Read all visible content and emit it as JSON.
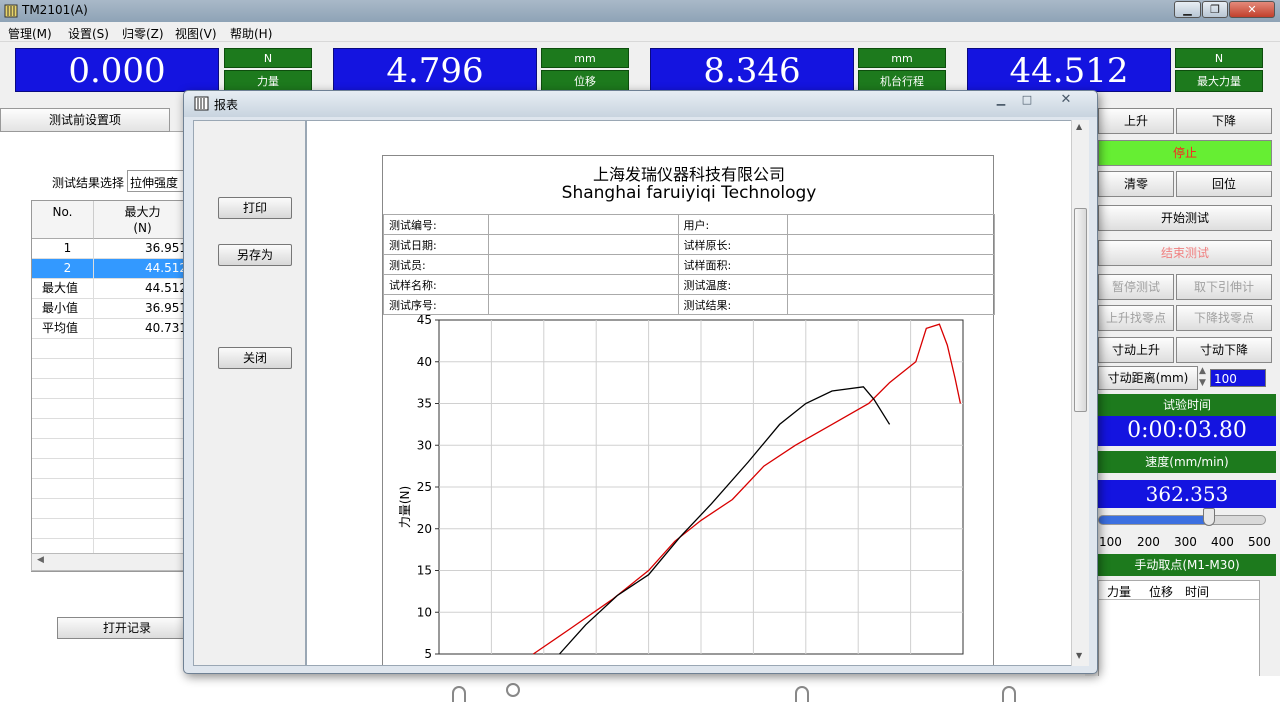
{
  "window": {
    "title": "TM2101(A)"
  },
  "menu": [
    "管理(M)",
    "设置(S)",
    "归零(Z)",
    "视图(V)",
    "帮助(H)"
  ],
  "readouts": [
    {
      "value": "0.000",
      "unit": "N",
      "label": "力量"
    },
    {
      "value": "4.796",
      "unit": "mm",
      "label": "位移"
    },
    {
      "value": "8.346",
      "unit": "mm",
      "label": "机台行程"
    },
    {
      "value": "44.512",
      "unit": "N",
      "label": "最大力量"
    }
  ],
  "left": {
    "tab": "测试前设置项",
    "select_label": "测试结果选择",
    "select_value": "拉伸强度",
    "grid_headers": [
      "No.",
      "最大力\n(N)"
    ],
    "rows": [
      {
        "no": "1",
        "val": "36.951",
        "selected": false
      },
      {
        "no": "2",
        "val": "44.512",
        "selected": true
      },
      {
        "no": "最大值",
        "val": "44.512",
        "selected": false
      },
      {
        "no": "最小值",
        "val": "36.951",
        "selected": false
      },
      {
        "no": "平均值",
        "val": "40.731",
        "selected": false
      }
    ],
    "open_button": "打开记录"
  },
  "right": {
    "up": "上升",
    "down": "下降",
    "stop": "停止",
    "zero": "清零",
    "return": "回位",
    "start": "开始测试",
    "end": "结束测试",
    "pause": "暂停测试",
    "remove_ext": "取下引伸计",
    "up_find_zero": "上升找零点",
    "down_find_zero": "下降找零点",
    "jog_up": "寸动上升",
    "jog_down": "寸动下降",
    "jog_dist_label": "寸动距离(mm)",
    "jog_dist_value": "100",
    "test_time_label": "试验时间",
    "test_time_value": "0:00:03.80",
    "speed_label": "速度(mm/min)",
    "speed_value": "362.353",
    "speed_scale": [
      "100",
      "200",
      "300",
      "400",
      "500"
    ],
    "speed_fraction": 0.66,
    "manual_label": "手动取点(M1-M30)",
    "manual_cols": [
      "力量",
      "位移",
      "时间"
    ]
  },
  "dialog": {
    "title": "报表",
    "print": "打印",
    "save_as": "另存为",
    "close": "关闭",
    "company_cn": "上海发瑞仪器科技有限公司",
    "company_en": "Shanghai faruiyiqi Technology",
    "fields": [
      [
        "测试编号:",
        "",
        "用户:",
        ""
      ],
      [
        "测试日期:",
        "",
        "试样原长:",
        ""
      ],
      [
        "测试员:",
        "",
        "试样面积:",
        ""
      ],
      [
        "试样名称:",
        "",
        "测试温度:",
        ""
      ],
      [
        "测试序号:",
        "",
        "测试结果:",
        ""
      ]
    ]
  },
  "chart_data": {
    "type": "line",
    "ylabel": "力量(N)",
    "ylim": [
      5,
      45
    ],
    "yticks": [
      5,
      10,
      15,
      20,
      25,
      30,
      35,
      40,
      45
    ],
    "xlim": [
      0,
      10
    ],
    "series": [
      {
        "color": "#d80000",
        "points": [
          [
            1.8,
            5
          ],
          [
            2.5,
            8
          ],
          [
            3.3,
            11.5
          ],
          [
            4.0,
            15
          ],
          [
            4.5,
            18.5
          ],
          [
            5.0,
            21
          ],
          [
            5.6,
            23.5
          ],
          [
            6.2,
            27.5
          ],
          [
            6.8,
            30
          ],
          [
            7.5,
            32.5
          ],
          [
            8.2,
            35
          ],
          [
            8.6,
            37.5
          ],
          [
            9.1,
            40
          ],
          [
            9.3,
            44
          ],
          [
            9.55,
            44.5
          ],
          [
            9.7,
            42
          ],
          [
            9.85,
            38
          ],
          [
            9.95,
            35
          ]
        ]
      },
      {
        "color": "#000000",
        "points": [
          [
            2.3,
            5
          ],
          [
            2.8,
            8.5
          ],
          [
            3.4,
            12
          ],
          [
            4.0,
            14.5
          ],
          [
            4.6,
            19
          ],
          [
            5.2,
            23
          ],
          [
            5.9,
            28
          ],
          [
            6.5,
            32.5
          ],
          [
            7.0,
            35
          ],
          [
            7.5,
            36.5
          ],
          [
            8.1,
            37
          ],
          [
            8.3,
            35.5
          ],
          [
            8.6,
            32.5
          ]
        ]
      }
    ]
  }
}
